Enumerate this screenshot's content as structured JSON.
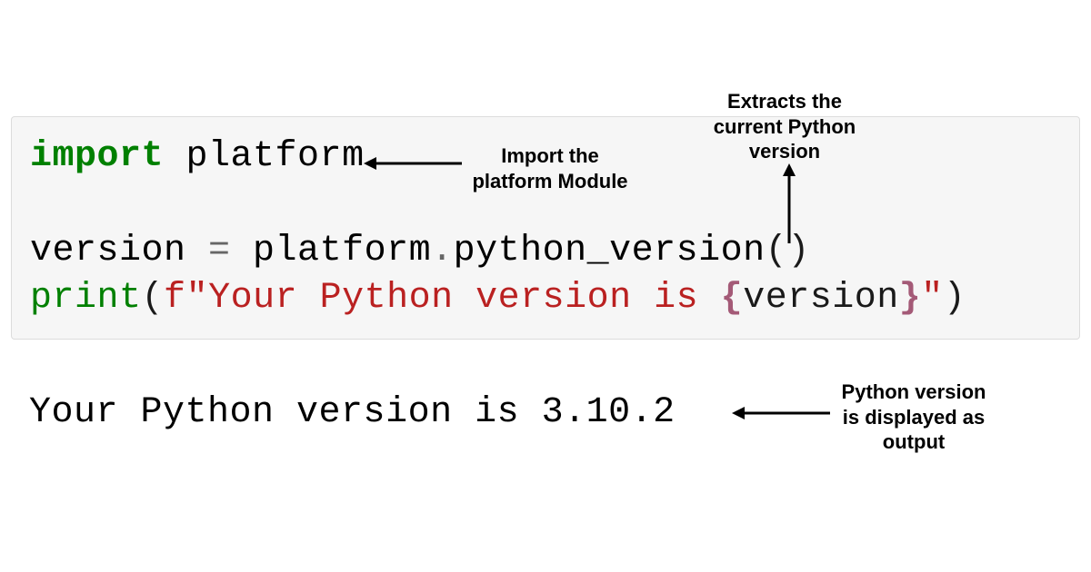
{
  "code": {
    "line1": {
      "kw": "import",
      "module": " platform"
    },
    "line2": {
      "var": "version ",
      "eq": "=",
      "expr1": " platform",
      "dot": ".",
      "fn": "python_version",
      "open": "(",
      "close": ")"
    },
    "line3": {
      "fn": "print",
      "open": "(",
      "fprefix": "f",
      "q1": "\"",
      "text": "Your Python version is ",
      "lbrace": "{",
      "var": "version",
      "rbrace": "}",
      "q2": "\"",
      "close": ")"
    }
  },
  "output": "Your Python version is 3.10.2",
  "annotations": {
    "a1": "Import the\nplatform Module",
    "a2": "Extracts the\ncurrent Python\nversion",
    "a3": "Python version\nis displayed as\noutput"
  }
}
